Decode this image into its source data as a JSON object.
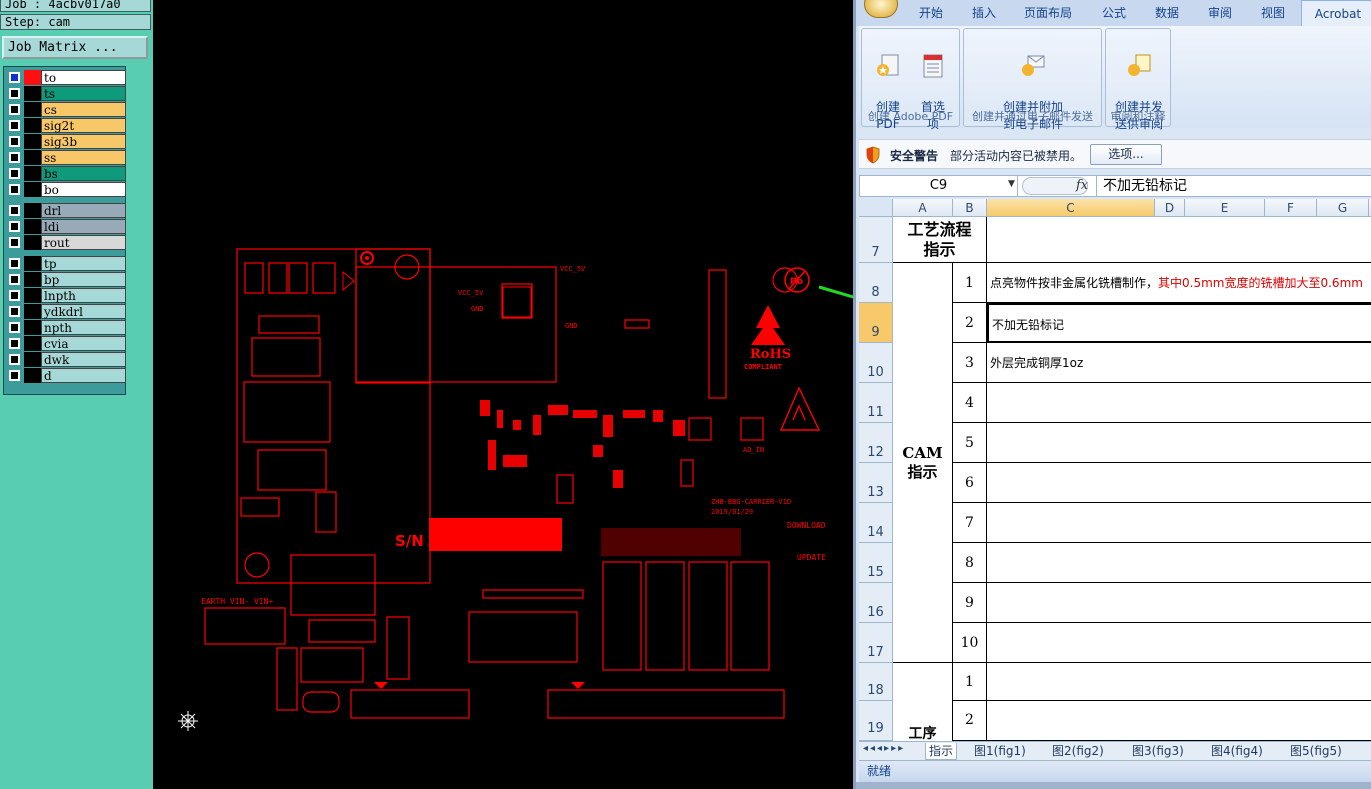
{
  "cam": {
    "job_label": "Job : 4acbv017a0",
    "step_label": "Step: cam",
    "job_matrix_label": "Job Matrix ...",
    "layers": [
      {
        "name": "to",
        "color": "#ffffff",
        "selected": true
      },
      {
        "name": "ts",
        "color": "#0f9a7c"
      },
      {
        "name": "cs",
        "color": "#f8c868"
      },
      {
        "name": "sig2t",
        "color": "#f8c868"
      },
      {
        "name": "sig3b",
        "color": "#f8c868"
      },
      {
        "name": "ss",
        "color": "#f8c868"
      },
      {
        "name": "bs",
        "color": "#0f9a7c"
      },
      {
        "name": "bo",
        "color": "#ffffff"
      },
      {
        "name": "drl",
        "color": "#98aab8"
      },
      {
        "name": "ldi",
        "color": "#98aab8"
      },
      {
        "name": "rout",
        "color": "#d8d8d8"
      },
      {
        "name": "tp",
        "color": "#a6d8d8"
      },
      {
        "name": "bp",
        "color": "#a6d8d8"
      },
      {
        "name": "lnpth",
        "color": "#a6d8d8"
      },
      {
        "name": "ydkdrl",
        "color": "#a6d8d8"
      },
      {
        "name": "npth",
        "color": "#a6d8d8"
      },
      {
        "name": "cvia",
        "color": "#a6d8d8"
      },
      {
        "name": "dwk",
        "color": "#a6d8d8"
      },
      {
        "name": "d",
        "color": "#a6d8d8"
      }
    ]
  },
  "pcb": {
    "labels": {
      "vcc_top": "VCC_5V",
      "vcc_mid": "VCC_5V",
      "gnd_a": "GND",
      "gnd_b": "GND",
      "sn": "S/N",
      "rohs": "RoHS",
      "compliant": "COMPLIANT",
      "pb": "Pb",
      "board_name": "ZHB-BBG-CARRIER-V1D",
      "board_date": "2019/01/29",
      "download": "DOWNLOAD",
      "update": "UPDATE",
      "earth": "EARTH  VIN-  VIN+",
      "ad_in": "AD_IN"
    }
  },
  "excel": {
    "tabs": [
      "开始",
      "插入",
      "页面布局",
      "公式",
      "数据",
      "审阅",
      "视图",
      "Acrobat"
    ],
    "groups": [
      {
        "label": "创建 Adobe PDF",
        "buttons": [
          "创建\nPDF",
          "首选\n项"
        ]
      },
      {
        "label": "创建并通过电子邮件发送",
        "buttons": [
          "创建并附加\n到电子邮件"
        ]
      },
      {
        "label": "审阅和注释",
        "buttons": [
          "创建并发\n送供审阅"
        ]
      }
    ],
    "security": {
      "title": "安全警告",
      "message": "部分活动内容已被禁用。",
      "button": "选项..."
    },
    "formula": {
      "cell_ref": "C9",
      "fx": "fx",
      "value": "不加无铅标记"
    },
    "columns": [
      "A",
      "B",
      "C",
      "D",
      "E",
      "F",
      "G"
    ],
    "rows": [
      "7",
      "8",
      "9",
      "10",
      "11",
      "12",
      "13",
      "14",
      "15",
      "16",
      "17",
      "18",
      "19"
    ],
    "header_cell": "工艺流程\n指示",
    "cam_cell": "CAM\n指示",
    "partial_cell": "工序",
    "items": [
      {
        "num": "1",
        "text": "点亮物件按非金属化铣槽制作，",
        "text_red": "其中0.5mm宽度的铣槽加大至0.6mm"
      },
      {
        "num": "2",
        "text": "不加无铅标记",
        "text_red": ""
      },
      {
        "num": "3",
        "text": "外层完成铜厚1oz",
        "text_red": ""
      },
      {
        "num": "4",
        "text": "",
        "text_red": ""
      },
      {
        "num": "5",
        "text": "",
        "text_red": ""
      },
      {
        "num": "6",
        "text": "",
        "text_red": ""
      },
      {
        "num": "7",
        "text": "",
        "text_red": ""
      },
      {
        "num": "8",
        "text": "",
        "text_red": ""
      },
      {
        "num": "9",
        "text": "",
        "text_red": ""
      },
      {
        "num": "10",
        "text": "",
        "text_red": ""
      }
    ],
    "next_items": [
      "1",
      "2"
    ],
    "sheet_tabs": [
      "指示",
      "图1(fig1)",
      "图2(fig2)",
      "图3(fig3)",
      "图4(fig4)",
      "图5(fig5)"
    ],
    "status": "就绪"
  },
  "colors": {
    "pcb_red": "#ff0000",
    "arrow_green": "#22d822",
    "excel_blue": "#15428b"
  }
}
